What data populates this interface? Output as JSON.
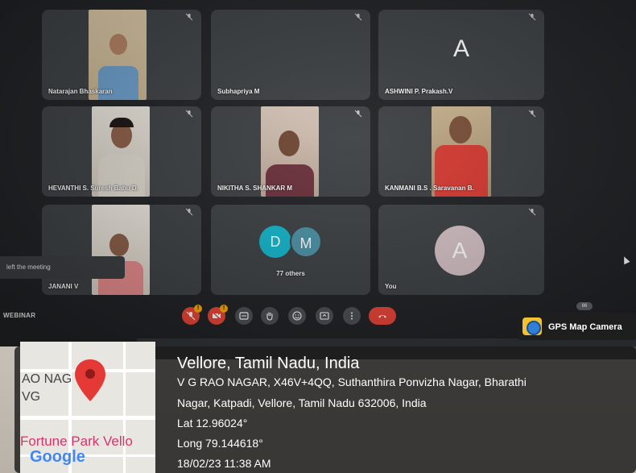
{
  "meeting": {
    "tiles": [
      {
        "name": "Natarajan Bhaskaran",
        "type": "video"
      },
      {
        "name": "Subhapriya M",
        "type": "blank"
      },
      {
        "name": "ASHWINI P. Prakash.V",
        "type": "avatar",
        "initial": "A"
      },
      {
        "name": "HEVANTHI S. Suresh Babu D.",
        "type": "video"
      },
      {
        "name": "NIKITHA S. SHANKAR M",
        "type": "video"
      },
      {
        "name": "KANMANI B.S . Saravanan B.",
        "type": "video"
      },
      {
        "name": "JANANI V",
        "type": "video"
      },
      {
        "name": "77 others",
        "type": "group",
        "initials": [
          "D",
          "M"
        ]
      },
      {
        "name": "You",
        "type": "avatar",
        "initial": "A"
      }
    ],
    "toast": "left the meeting",
    "meeting_title": "WEBINAR",
    "participant_count": "86",
    "badge_alert": "!"
  },
  "colors": {
    "tile_bg": "#3c4043",
    "screen_bg": "#1f2124",
    "end_call": "#ea4335",
    "avatar_d": "#12b5cb",
    "avatar_m": "#4a90a4",
    "avatar_you": "#d4c1c6"
  },
  "gps": {
    "app_name": "GPS Map Camera",
    "location_title": "Vellore, Tamil Nadu, India",
    "address_line1": "V G RAO NAGAR, X46V+4QQ, Suthanthira Ponvizha Nagar, Bharathi",
    "address_line2": "Nagar, Katpadi, Vellore, Tamil Nadu 632006, India",
    "lat": "Lat 12.96024°",
    "long": "Long 79.144618°",
    "datetime": "18/02/23 11:38 AM",
    "map_label1": "AO NAG",
    "map_label2": "VG",
    "map_label3": "Fortune Park Vello",
    "map_brand": "Google"
  }
}
